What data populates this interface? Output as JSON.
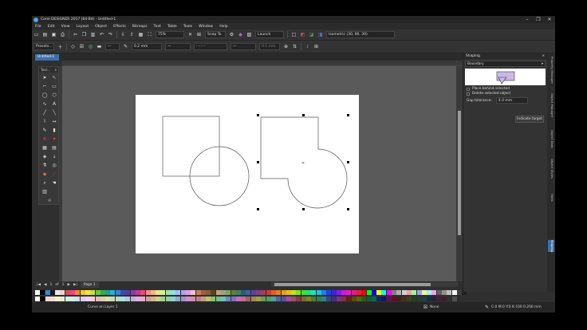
{
  "window": {
    "title": "Corel DESIGNER 2017 (64-Bit) - Untitled-1",
    "controls": [
      "–",
      "❐",
      "✕"
    ]
  },
  "menu": [
    "File",
    "Edit",
    "View",
    "Layout",
    "Object",
    "Effects",
    "Bitmaps",
    "Text",
    "Table",
    "Tools",
    "Window",
    "Help"
  ],
  "toolbar1": {
    "zoom": "75%",
    "snap": "Snap To",
    "launch": "Launch",
    "projection": "Isometric (30, 90, 30)"
  },
  "toolbar2": {
    "preset": "Presets...",
    "outline_width": "0.2 mm",
    "offset": "0.1 mm"
  },
  "document_tab": "Untitled-1",
  "toolbox": {
    "title": "Tool...",
    "close": "x"
  },
  "pagebar": {
    "first": "|◀",
    "prev": "◀",
    "page_index": "1",
    "of": "of",
    "page_count": "1",
    "next": "▶",
    "last": "▶|",
    "page_label": "Page 1"
  },
  "docker": {
    "title": "Shaping",
    "mode": "Boundary",
    "place_behind": "Place behind selected",
    "delete_selected": "Delete selected object",
    "gap_label": "Gap tolerance:",
    "gap_value": "4.0 mm",
    "button": "Indicate target"
  },
  "sidetabs": [
    "Property Manager",
    "Object Manager",
    "Object Data",
    "Object Styles",
    "Hints",
    "Shaping"
  ],
  "status": {
    "layer": "Curve on Layer 1",
    "fill": "None",
    "outline": "C:0 M:0 Y:0 K:100 0.200 mm"
  },
  "palette_row1": [
    "#ffffff",
    "#000000",
    "#3a86c8",
    "#1a1a1a",
    "#e8e8e8",
    "#f2d0d0",
    "#d25050",
    "#e84a8a",
    "#f08a2a",
    "#f2c530",
    "#f2e63a",
    "#c8e040",
    "#66c440",
    "#3aa850",
    "#2a9a8a",
    "#2ab0d0",
    "#3a80d0",
    "#3a50b0",
    "#5a3aa0",
    "#8a3aa8",
    "#c03a98",
    "#e05070",
    "#f09090",
    "#f0b880",
    "#f0e090",
    "#d0f0a0",
    "#a0e0b0",
    "#90e0e0",
    "#a0c0f0",
    "#b0a0f0",
    "#e0a0e0",
    "#f0c0d0",
    "#c08060",
    "#a06040",
    "#806040",
    "#604020",
    "#c0a080",
    "#a0a080",
    "#80a060",
    "#608040",
    "#408060",
    "#206080",
    "#4060a0",
    "#6040a0",
    "#804080",
    "#a04060",
    "#c04040",
    "#e06020",
    "#e08020",
    "#e0a020",
    "#e0c020",
    "#c0e020",
    "#80e020",
    "#40e040",
    "#20e080",
    "#20e0c0",
    "#20c0e0",
    "#2080e0",
    "#2040e0",
    "#4020e0",
    "#8020e0",
    "#c020e0",
    "#e020c0",
    "#e02080",
    "#e02040",
    "#ff0000",
    "#00ff00",
    "#0000ff",
    "#ffff00",
    "#00ffff",
    "#ff00ff",
    "#808080",
    "#b0b0b0",
    "#d0d0d0",
    "#f0a0a0",
    "#a0f0a0",
    "#a0a0f0",
    "#f0f0a0",
    "#a0f0f0",
    "#f0a0f0",
    "#606060",
    "#909090",
    "#c0c0c0",
    "#f8f8f8",
    "#404040",
    "#202020"
  ],
  "palette_row2": [
    "#ffffff",
    "#000000",
    "#f0d8d8",
    "#f0e0d0",
    "#f0f0d0",
    "#e0f0d0",
    "#d0f0e0",
    "#d0f0f0",
    "#d0e0f0",
    "#d8d0f0",
    "#f0d0f0",
    "#f0d0e0",
    "#e0c0c0",
    "#e0d0b0",
    "#e0e0b0",
    "#c8e0b0",
    "#b0e0c8",
    "#b0e0e0",
    "#b0c8e0",
    "#c0b0e0",
    "#e0b0e0",
    "#e0b0c8",
    "#d0a0a0",
    "#d0b890",
    "#d0d090",
    "#a8d090",
    "#90d0a8",
    "#90d0d0",
    "#90a8d0",
    "#a090d0",
    "#d090d0",
    "#d090a8",
    "#c08080",
    "#c0a070",
    "#c0c070",
    "#88c070",
    "#70c088",
    "#70c0c0",
    "#7088c0",
    "#8070c0",
    "#c070c0",
    "#c07088",
    "#a06060",
    "#a08850",
    "#a0a050",
    "#68a050",
    "#50a068",
    "#50a0a0",
    "#5068a0",
    "#6050a0",
    "#a050a0",
    "#a05068",
    "#804040",
    "#806830",
    "#808030",
    "#488030",
    "#308048",
    "#308080",
    "#304880",
    "#403080",
    "#803080",
    "#803048",
    "#602020",
    "#604810",
    "#606010",
    "#286010",
    "#106028",
    "#106060",
    "#102860",
    "#201060",
    "#601060",
    "#601028",
    "#402020",
    "#403020",
    "#404020",
    "#204020",
    "#204030",
    "#204040",
    "#202840",
    "#282040",
    "#402040",
    "#402028",
    "#303030",
    "#505050"
  ]
}
